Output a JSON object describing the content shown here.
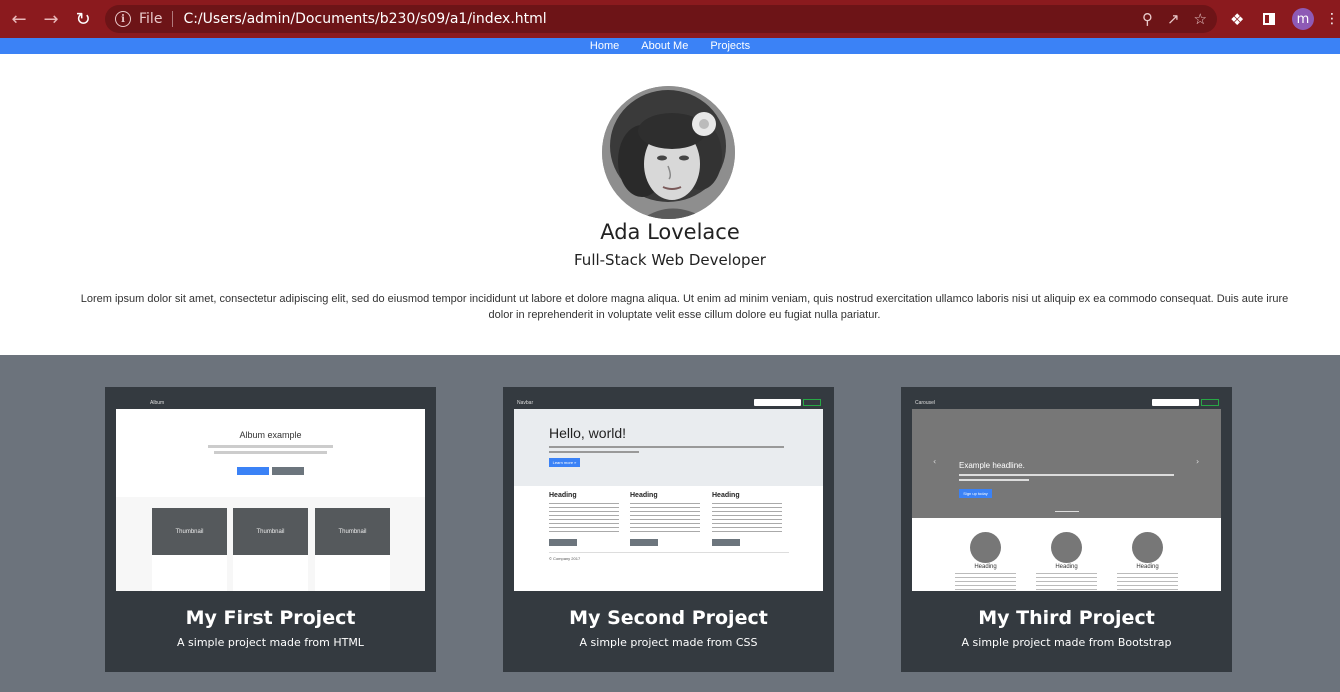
{
  "browser": {
    "file_label": "File",
    "url": "C:/Users/admin/Documents/b230/s09/a1/index.html",
    "profile_initial": "m"
  },
  "nav": {
    "items": [
      "Home",
      "About Me",
      "Projects"
    ]
  },
  "hero": {
    "name": "Ada Lovelace",
    "role": "Full-Stack Web Developer",
    "bio": "Lorem ipsum dolor sit amet, consectetur adipiscing elit, sed do eiusmod tempor incididunt ut labore et dolore magna aliqua. Ut enim ad minim veniam, quis nostrud exercitation ullamco laboris nisi ut aliquip ex ea commodo consequat. Duis aute irure dolor in reprehenderit in voluptate velit esse cillum dolore eu fugiat nulla pariatur."
  },
  "projects": [
    {
      "title": "My First Project",
      "subtitle": "A simple project made from HTML",
      "preview": {
        "brand": "Album",
        "heading": "Album example",
        "cards": [
          "Thumbnail",
          "Thumbnail",
          "Thumbnail"
        ]
      }
    },
    {
      "title": "My Second Project",
      "subtitle": "A simple project made from CSS",
      "preview": {
        "brand": "Navbar",
        "heading": "Hello, world!",
        "button": "Learn more »",
        "columns": [
          "Heading",
          "Heading",
          "Heading"
        ],
        "footer": "© Company 2017"
      }
    },
    {
      "title": "My Third Project",
      "subtitle": "A simple project made from Bootstrap",
      "preview": {
        "brand": "Carousel",
        "heading": "Example headline.",
        "button": "Sign up today",
        "columns": [
          "Heading",
          "Heading",
          "Heading"
        ]
      }
    }
  ],
  "colors": {
    "chrome": "#8b1a1e",
    "navbar": "#3b82f6",
    "projects_bg": "#6c737c",
    "card_bg": "#343a40"
  }
}
